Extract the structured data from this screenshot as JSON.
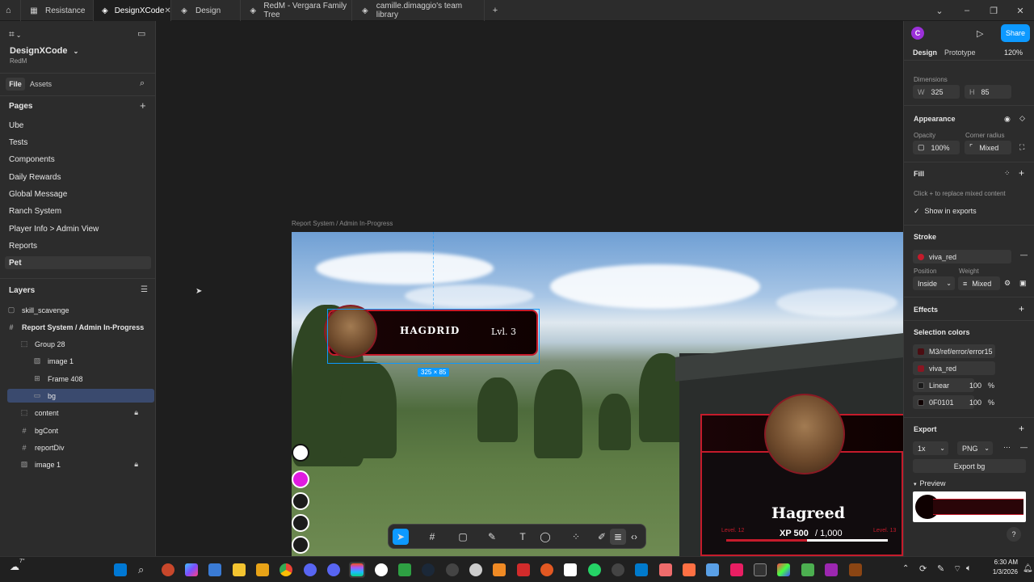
{
  "tabs": [
    {
      "label": "Resistance",
      "active": false
    },
    {
      "label": "DesignXCode",
      "active": true
    },
    {
      "label": "Design",
      "active": false
    },
    {
      "label": "RedM - Vergara Family Tree",
      "active": false
    },
    {
      "label": "camille.dimaggio's team library",
      "active": false
    }
  ],
  "file": {
    "name": "DesignXCode",
    "team": "RedM"
  },
  "left_tabs": {
    "file": "File",
    "assets": "Assets"
  },
  "pages": {
    "header": "Pages",
    "items": [
      "Ube",
      "Tests",
      "Components",
      "Daily Rewards",
      "Global Message",
      "Ranch System",
      "Player Info > Admin View",
      "Reports",
      "Pet"
    ]
  },
  "layers": {
    "header": "Layers",
    "items": [
      {
        "label": "skill_scavenge",
        "icon": "frame-icon",
        "locked": false
      },
      {
        "label": "Report System / Admin In-Progress",
        "icon": "frame-icon",
        "locked": false
      },
      {
        "label": "Group 28",
        "icon": "group-icon",
        "locked": false
      },
      {
        "label": "image 1",
        "icon": "image-icon",
        "locked": false
      },
      {
        "label": "Frame 408",
        "icon": "frame-icon",
        "locked": false
      },
      {
        "label": "bg",
        "icon": "rectangle-icon",
        "locked": false,
        "selected": true
      },
      {
        "label": "content",
        "icon": "frame-icon",
        "locked": true
      },
      {
        "label": "bgCont",
        "icon": "frame-icon",
        "locked": false
      },
      {
        "label": "reportDiv",
        "icon": "frame-icon",
        "locked": false
      },
      {
        "label": "image 1",
        "icon": "image-icon",
        "locked": true
      }
    ]
  },
  "canvas": {
    "frame_label": "Report System / Admin In-Progress",
    "selection_size": "325 × 85",
    "card_small": {
      "name": "HAGDRID",
      "level": "Lvl. 3"
    },
    "card_large": {
      "name": "Hagreed",
      "xp": "XP 500",
      "xp_total": "/ 1,000",
      "level_left": "Level. 12",
      "level_right": "Level. 13"
    }
  },
  "right": {
    "avatar_letter": "C",
    "share": "Share",
    "tabs": {
      "design": "Design",
      "prototype": "Prototype",
      "zoom": "120%"
    },
    "dimensions": {
      "label": "Dimensions",
      "w_label": "W",
      "w": "325",
      "h_label": "H",
      "h": "85"
    },
    "appearance": {
      "label": "Appearance",
      "opacity_label": "Opacity",
      "opacity": "100%",
      "radius_label": "Corner radius",
      "radius": "Mixed"
    },
    "fill": {
      "label": "Fill",
      "hint": "Click + to replace mixed content",
      "show_exports": "Show in exports"
    },
    "stroke": {
      "label": "Stroke",
      "color_name": "viva_red",
      "position_label": "Position",
      "position": "Inside",
      "weight_label": "Weight",
      "weight": "Mixed"
    },
    "effects": {
      "label": "Effects"
    },
    "selection_colors": {
      "label": "Selection colors",
      "items": [
        {
          "name": "M3/ref/error/error15",
          "color": "#4b0d12"
        },
        {
          "name": "viva_red",
          "color": "#8a1622"
        },
        {
          "name": "Linear",
          "color": "#1a1a1a",
          "pct": "100",
          "unit": "%"
        },
        {
          "name": "0F0101",
          "color": "#0f0101",
          "pct": "100",
          "unit": "%"
        }
      ]
    },
    "export": {
      "label": "Export",
      "scale": "1x",
      "format": "PNG",
      "button": "Export bg",
      "preview": "Preview"
    }
  },
  "taskbar": {
    "time": "6:30 AM",
    "date": "1/3/2026",
    "weather": "7°"
  },
  "colors": {
    "accent": "#0d99ff",
    "brand_red": "#c51b2b"
  }
}
